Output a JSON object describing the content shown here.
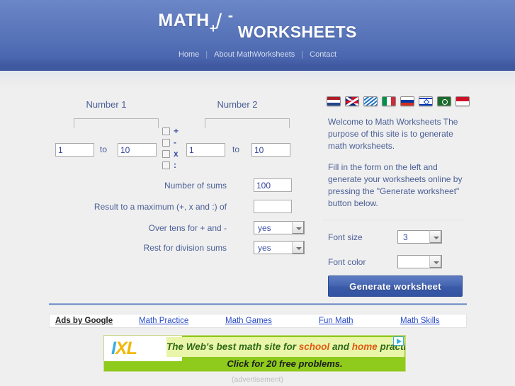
{
  "header": {
    "logo_math": "MATH",
    "logo_plus": "+",
    "logo_slash": "/",
    "logo_minus": "-",
    "logo_worksheets": "WORKSHEETS",
    "nav": [
      {
        "label": "Home"
      },
      {
        "label": "About MathWorksheets"
      },
      {
        "label": "Contact"
      }
    ],
    "nav_separator": "|"
  },
  "form": {
    "number1_title": "Number 1",
    "number2_title": "Number 2",
    "to_label_1": "to",
    "to_label_2": "to",
    "number1_from": "1",
    "number1_to": "10",
    "number2_from": "1",
    "number2_to": "10",
    "operators": [
      {
        "symbol": "+",
        "checked": false
      },
      {
        "symbol": "-",
        "checked": false
      },
      {
        "symbol": "x",
        "checked": false
      },
      {
        "symbol": ":",
        "checked": false
      }
    ],
    "rows": [
      {
        "label": "Number of sums",
        "value": "100",
        "type": "text"
      },
      {
        "label": "Result to a maximum (+, x and :) of",
        "value": "",
        "type": "text"
      },
      {
        "label": "Over tens for + and -",
        "value": "yes",
        "type": "select"
      },
      {
        "label": "Rest for division sums",
        "value": "yes",
        "type": "select"
      }
    ]
  },
  "sidebar": {
    "flags": [
      {
        "name": "flag-netherlands"
      },
      {
        "name": "flag-united-kingdom"
      },
      {
        "name": "flag-frisian"
      },
      {
        "name": "flag-italy"
      },
      {
        "name": "flag-russia"
      },
      {
        "name": "flag-israel"
      },
      {
        "name": "flag-arab-league"
      },
      {
        "name": "flag-indonesia"
      }
    ],
    "welcome_p1": "Welcome to Math Worksheets The purpose of this site is to generate math worksheets.",
    "welcome_p2": "Fill in the form on the left and generate your worksheets online by pressing the \"Generate worksheet\" button below.",
    "font_size_label": "Font size",
    "font_size_value": "3",
    "font_color_label": "Font color",
    "font_color_value": "",
    "generate_button": "Generate worksheet"
  },
  "ads": {
    "ads_by_google": "Ads by Google",
    "links": [
      {
        "label": "Math Practice"
      },
      {
        "label": "Math Games"
      },
      {
        "label": "Fun Math"
      },
      {
        "label": "Math Skills"
      }
    ],
    "banner": {
      "logo_i": "I",
      "logo_x": "X",
      "logo_l": "L",
      "line1_pre": "The Web's best math site for ",
      "line1_hl1": "school",
      "line1_mid": " and ",
      "line1_hl2": "home",
      "line1_post": " practice",
      "line2": "Click for 20 free problems."
    },
    "advertisement_label": "(advertisement)"
  },
  "colors": {
    "header_blue": "#5874b9",
    "accent_blue": "#3b5aa8",
    "text_blue": "#4a5f96",
    "link_blue": "#2a4bc8",
    "banner_green": "#8ecb1c"
  }
}
